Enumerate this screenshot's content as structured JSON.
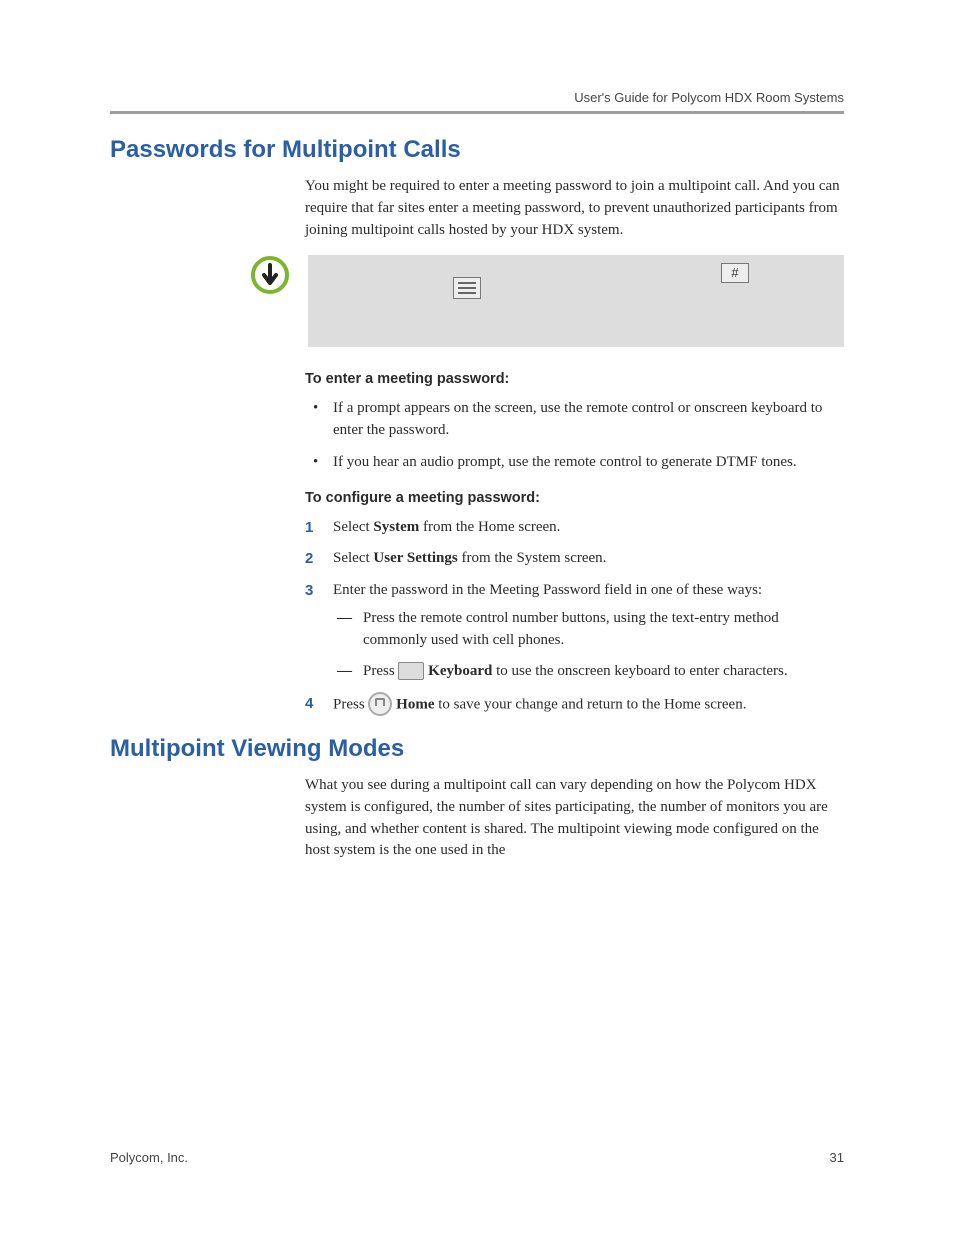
{
  "runningHead": "User's Guide for Polycom HDX Room Systems",
  "section1": {
    "title": "Passwords for Multipoint Calls",
    "intro": "You might be required to enter a meeting password to join a multipoint call. And you can require that far sites enter a meeting password, to prevent unauthorized participants from joining multipoint calls hosted by your HDX system.",
    "noteHashChar": "#",
    "subheadEnter": "To enter a meeting password:",
    "bullets": [
      "If a prompt appears on the screen, use the remote control  or onscreen keyboard to enter the password.",
      "If you hear an audio prompt, use the remote control to generate DTMF tones."
    ],
    "subheadConfigure": "To configure a meeting password:",
    "step1_a": "Select ",
    "step1_bold": "System",
    "step1_b": " from the Home screen.",
    "step2_a": "Select ",
    "step2_bold": "User Settings",
    "step2_b": " from the System screen.",
    "step3_a": "Enter the password in the Meeting Password field in one of these ways:",
    "step3_sub1": "Press the remote control number buttons, using the text-entry method commonly used with cell phones.",
    "step3_sub2_a": "Press ",
    "step3_sub2_bold": "Keyboard",
    "step3_sub2_b": " to use the onscreen keyboard to enter characters.",
    "step4_a": "Press ",
    "step4_bold": "Home",
    "step4_b": " to save your change and return to the Home screen."
  },
  "section2": {
    "title": "Multipoint Viewing Modes",
    "intro": "What you see during a multipoint call can vary depending on how the Polycom HDX system is configured, the number of sites participating, the number of monitors you are using, and whether content is shared. The multipoint viewing mode configured on the host system is the one used in the"
  },
  "footer": {
    "left": "Polycom, Inc.",
    "right": "31"
  }
}
